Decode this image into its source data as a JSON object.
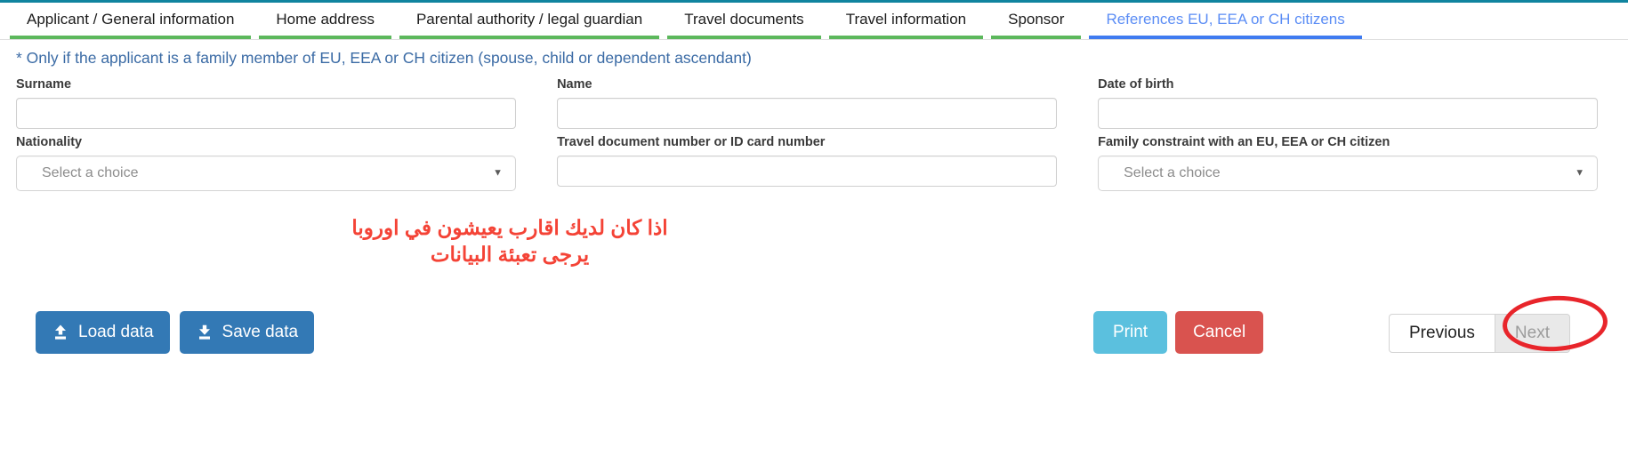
{
  "theme": {
    "top_rule_color": "#10849f",
    "tab_done_color": "#5cb85c",
    "tab_active_color": "#3f7bf0",
    "notice_color": "#3b6ba5",
    "annotation_color": "#f44336",
    "primary_button_color": "#3379b5",
    "print_button_color": "#5bc0de",
    "cancel_button_color": "#d9534f",
    "highlight_ellipse_color": "#e8252b"
  },
  "tabs": [
    {
      "label": "Applicant / General information",
      "state": "completed"
    },
    {
      "label": "Home address",
      "state": "completed"
    },
    {
      "label": "Parental authority / legal guardian",
      "state": "completed"
    },
    {
      "label": "Travel documents",
      "state": "completed"
    },
    {
      "label": "Travel information",
      "state": "completed"
    },
    {
      "label": "Sponsor",
      "state": "completed"
    },
    {
      "label": "References EU, EEA or CH citizens",
      "state": "active"
    }
  ],
  "notice": "* Only if the applicant is a family member of EU, EEA or CH citizen (spouse, child or dependent ascendant)",
  "form": {
    "row1": [
      {
        "label": "Surname",
        "type": "text",
        "value": "",
        "placeholder": ""
      },
      {
        "label": "Name",
        "type": "text",
        "value": "",
        "placeholder": ""
      },
      {
        "label": "Date of birth",
        "type": "text",
        "value": "",
        "placeholder": ""
      }
    ],
    "row2": [
      {
        "label": "Nationality",
        "type": "select",
        "value": "Select a choice",
        "arrow": "▼"
      },
      {
        "label": "Travel document number or ID card number",
        "type": "text",
        "value": "",
        "placeholder": ""
      },
      {
        "label": "Family constraint with an EU, EEA or CH citizen",
        "type": "select",
        "value": "Select a choice",
        "arrow": "▼"
      }
    ]
  },
  "annotation": {
    "line1": "اذا كان لديك اقارب يعيشون في اوروبا",
    "line2": "يرجى تعبئة البيانات"
  },
  "footer": {
    "load_data": "Load data",
    "save_data": "Save data",
    "print": "Print",
    "cancel": "Cancel",
    "previous": "Previous",
    "next": "Next",
    "load_icon": "upload-icon",
    "save_icon": "download-icon"
  }
}
